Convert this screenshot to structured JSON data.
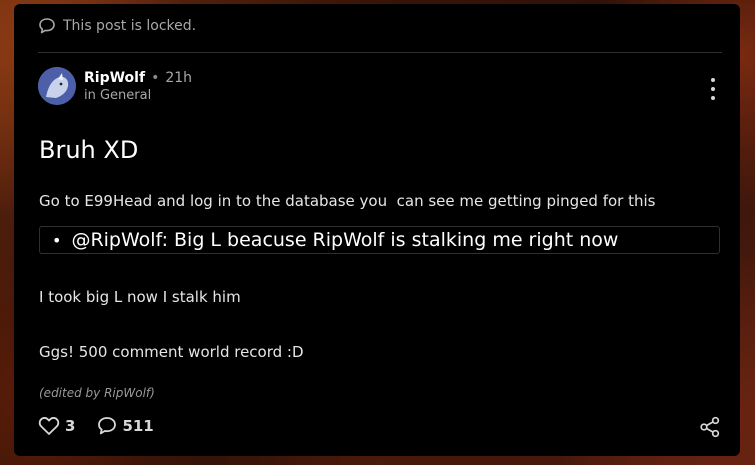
{
  "post": {
    "locked_text": "This post is locked.",
    "author": "RipWolf",
    "separator": "•",
    "time": "21h",
    "category": "in General",
    "title": "Bruh XD",
    "paragraph_1": "Go to E99Head and log in to the database you  can see me getting pinged for this",
    "quote_bullet": "•",
    "quote_text": "@RipWolf: Big L beacuse RipWolf is stalking me right now",
    "paragraph_2": "I took big L now I stalk him",
    "paragraph_3": "Ggs! 500 comment world record :D",
    "edited_note": "(edited by RipWolf)"
  },
  "actions": {
    "likes": "3",
    "comments": "511"
  },
  "icons": {
    "locked": "speech-bubble-icon",
    "menu": "kebab-menu-icon",
    "like": "heart-icon",
    "comment": "comment-icon",
    "share": "share-icon"
  },
  "colors": {
    "card_bg": "#000000",
    "text_primary": "#ffffff",
    "text_muted": "#a8a8a8"
  }
}
